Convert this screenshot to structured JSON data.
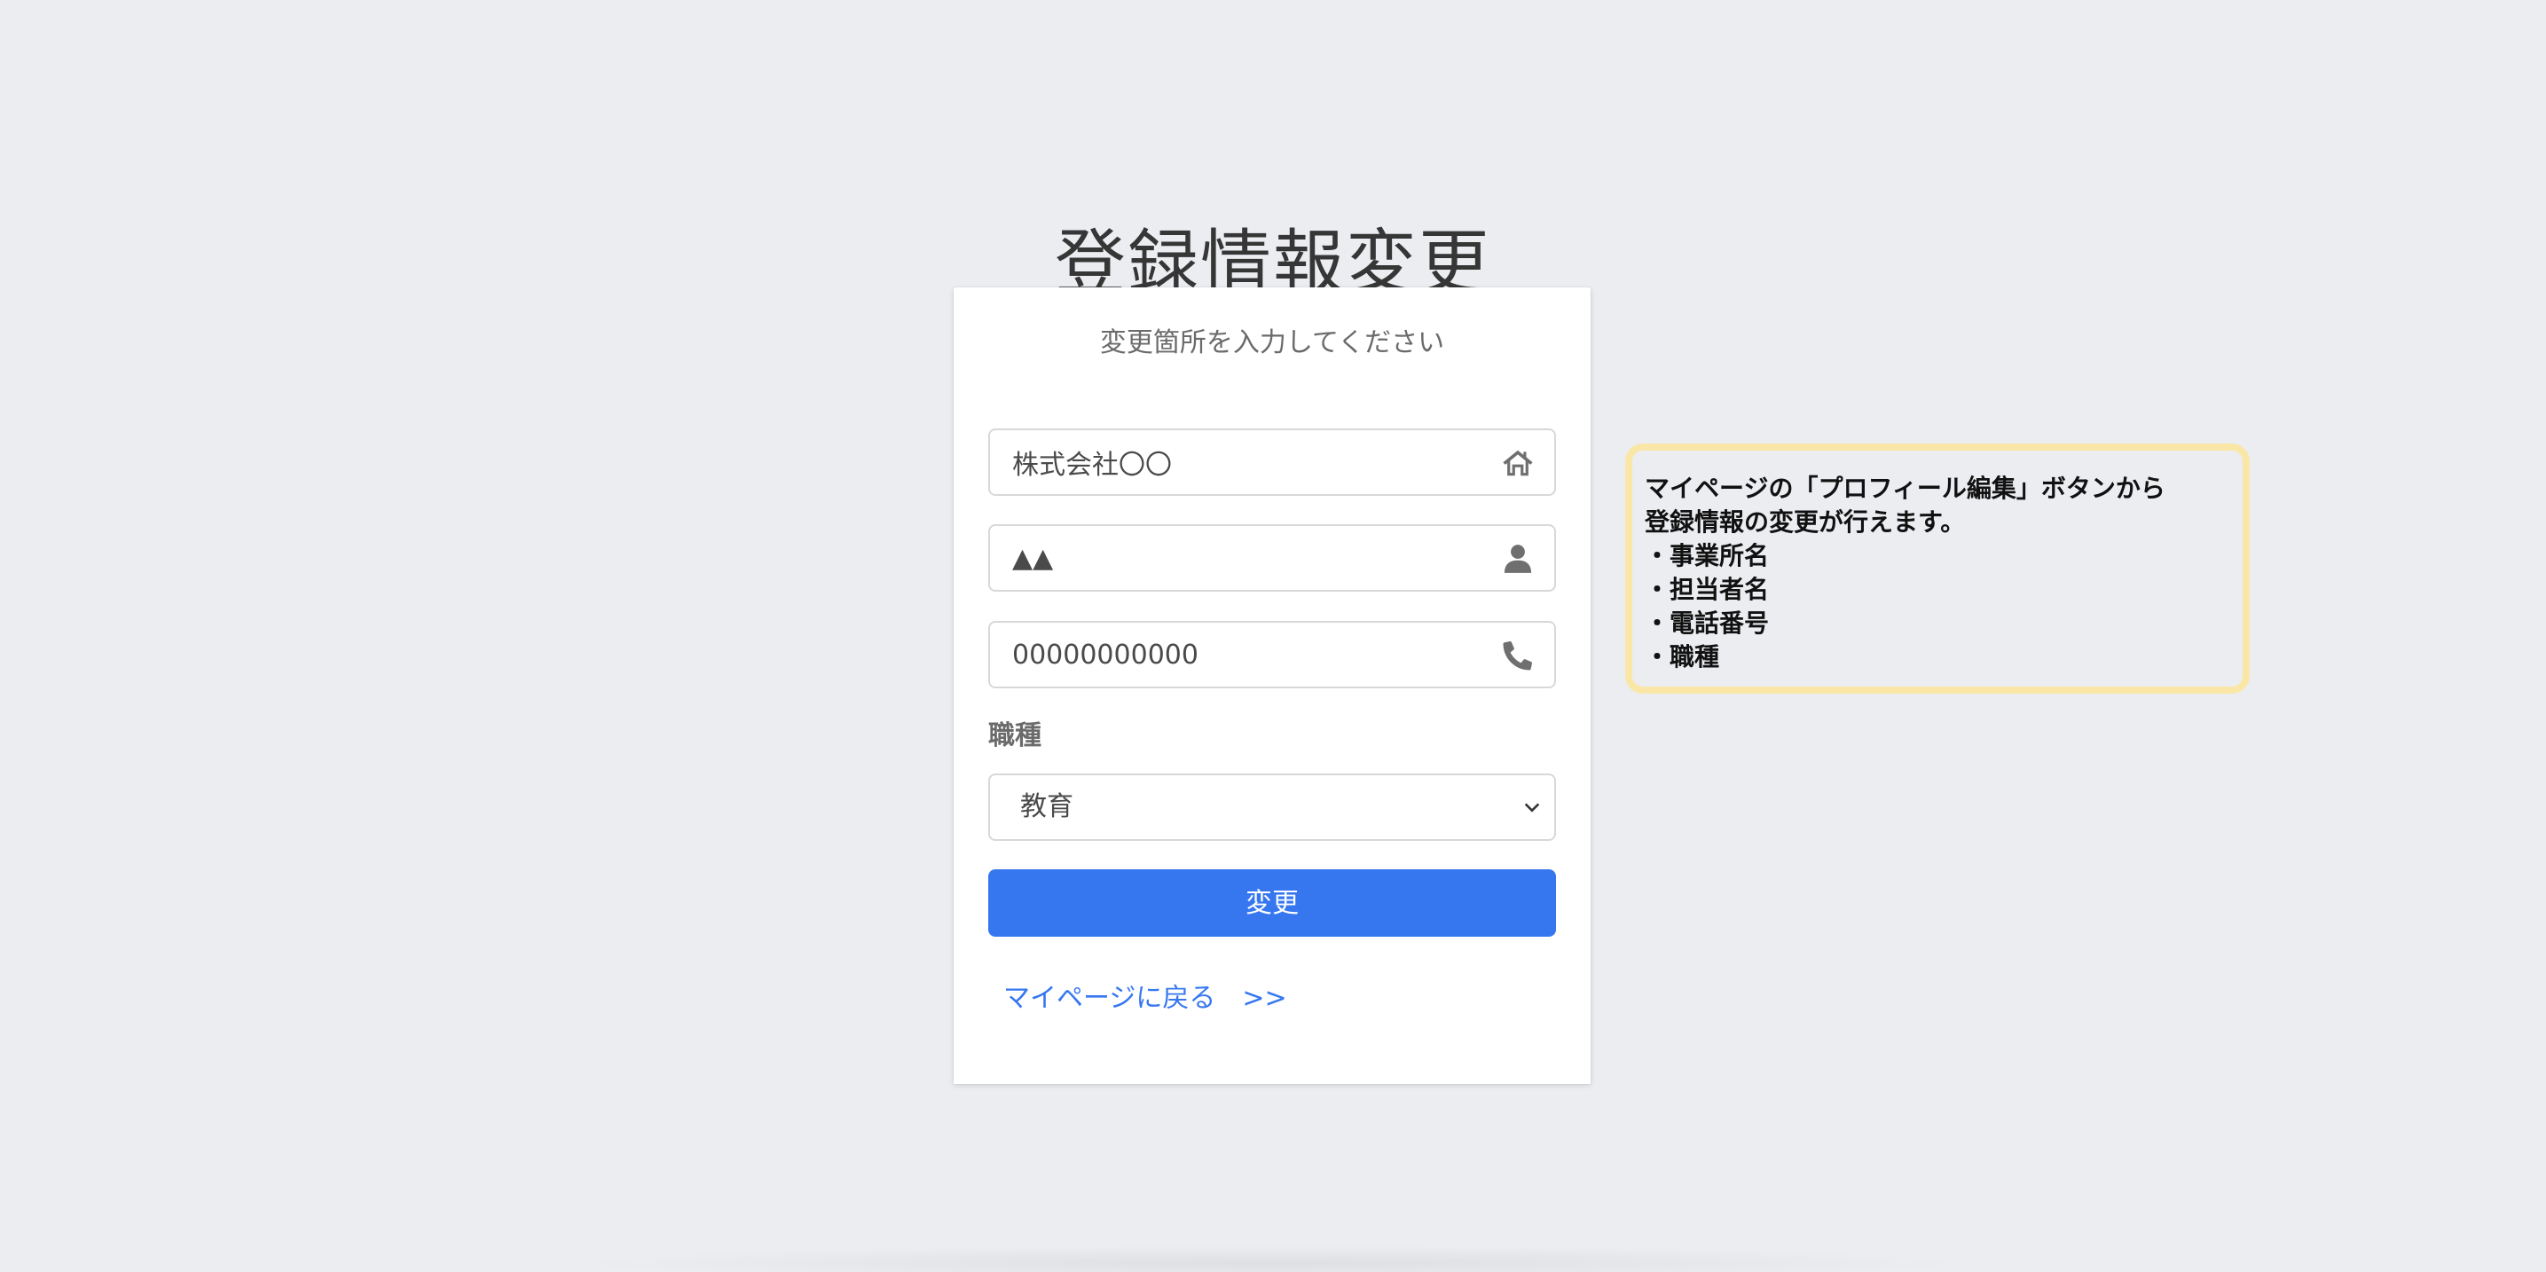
{
  "page": {
    "title": "登録情報変更"
  },
  "form": {
    "subtitle": "変更箇所を入力してください",
    "office_name": "株式会社〇〇",
    "contact_name": "▲▲",
    "phone": "00000000000",
    "job_label": "職種",
    "job_selected": "教育",
    "submit_label": "変更",
    "back_link": "マイページに戻る　>>"
  },
  "note": {
    "lines": [
      "マイページの「プロフィール編集」ボタンから",
      "登録情報の変更が行えます。",
      "・事業所名",
      "・担当者名",
      "・電話番号",
      "・職種"
    ],
    "border_color": "#fae7a8"
  },
  "icons": {
    "office_field": "home-icon",
    "contact_field": "user-icon",
    "phone_field": "phone-icon",
    "select": "chevron-down-icon"
  },
  "colors": {
    "accent": "#3677f0",
    "background": "#ebedf1"
  }
}
